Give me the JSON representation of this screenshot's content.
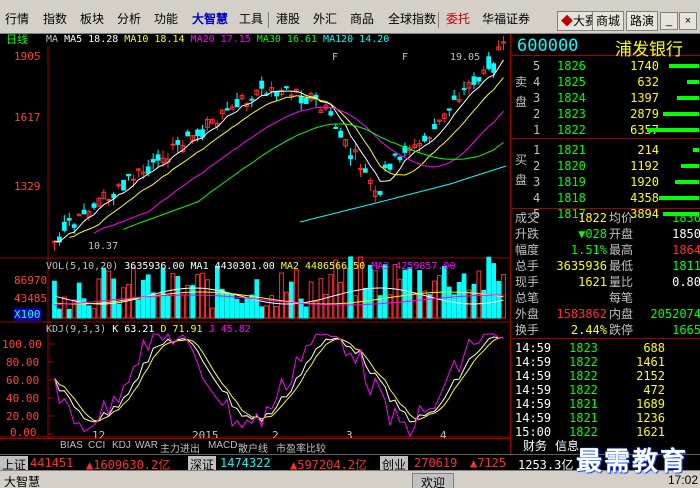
{
  "menu": {
    "items": [
      "行情",
      "指数",
      "板块",
      "分析",
      "功能",
      "大智慧",
      "工具",
      "港股",
      "外汇",
      "商品",
      "全球指数",
      "委托",
      "华福证券"
    ],
    "right_buttons": {
      "dasai": "大赛",
      "shangcheng": "商城",
      "luxiao": "路演"
    },
    "win": {
      "min": "_",
      "max": "□",
      "close": "×"
    }
  },
  "chart": {
    "period_label": "日线",
    "ma_line": {
      "ma": "MA",
      "ma5": "MA5 18.28",
      "ma10": "MA10 18.14",
      "ma20": "MA20 17.15",
      "ma30": "MA30 16.61",
      "ma120": "MA120 14.20"
    },
    "price_ticks": [
      "1905",
      "1617",
      "1329"
    ],
    "high_label": "19.05",
    "low_label": "10.37",
    "markers": {
      "f1": "F",
      "f2": "F"
    },
    "vol_line": {
      "vol": "VOL(5,10,20)",
      "v1": "3635936.00",
      "ma1": "MA1 4430301.00",
      "ma2": "MA2 4486566.50",
      "ma3": "MA3 4259857.00"
    },
    "vol_ticks": [
      "86970",
      "43485",
      "X100"
    ],
    "kdj_line": {
      "kdj": "KDJ(9,3,3)",
      "k": "K 63.21",
      "d": "D 71.91",
      "j": "J 45.82"
    },
    "kdj_ticks": [
      "100.00",
      "80.00",
      "60.00",
      "40.00",
      "20.00",
      "0.00"
    ],
    "x_labels": [
      "12",
      "2015",
      "2",
      "3",
      "4"
    ],
    "colors": {
      "ma5": "#ffffff",
      "ma10": "#ffff00",
      "ma20": "#ff00ff",
      "ma30": "#00ff00",
      "ma120": "#00ffff",
      "up": "#ff3030",
      "down": "#00ffff"
    }
  },
  "bottom_tabs": [
    "BIAS",
    "CCI",
    "KDJ",
    "WAR",
    "主力进出",
    "MACD",
    "散户线",
    "市盈率比较"
  ],
  "quote": {
    "code": "600000",
    "name": "浦发银行",
    "sell_label": "卖盘",
    "buy_label": "买盘",
    "sell": [
      {
        "n": "5",
        "p": "1826",
        "v": "1740"
      },
      {
        "n": "4",
        "p": "1825",
        "v": "632"
      },
      {
        "n": "3",
        "p": "1824",
        "v": "1397"
      },
      {
        "n": "2",
        "p": "1823",
        "v": "2879"
      },
      {
        "n": "1",
        "p": "1822",
        "v": "6357"
      }
    ],
    "buy": [
      {
        "n": "1",
        "p": "1821",
        "v": "214"
      },
      {
        "n": "2",
        "p": "1820",
        "v": "1192"
      },
      {
        "n": "3",
        "p": "1819",
        "v": "1920"
      },
      {
        "n": "4",
        "p": "1818",
        "v": "4358"
      },
      {
        "n": "5",
        "p": "1817",
        "v": "3894"
      }
    ],
    "stats": [
      {
        "l1": "成交",
        "v1": "1822",
        "l2": "均价",
        "v2": "1836"
      },
      {
        "l1": "升跌",
        "v1": "▼028",
        "l2": "开盘",
        "v2": "1850"
      },
      {
        "l1": "幅度",
        "v1": "1.51%",
        "l2": "最高",
        "v2": "1864"
      },
      {
        "l1": "总手",
        "v1": "3635936",
        "l2": "最低",
        "v2": "1811"
      },
      {
        "l1": "现手",
        "v1": "1621",
        "l2": "量比",
        "v2": "0.80"
      },
      {
        "l1": "总笔",
        "v1": "",
        "l2": "每笔",
        "v2": ""
      },
      {
        "l1": "外盘",
        "v1": "1583862",
        "l2": "内盘",
        "v2": "2052074"
      },
      {
        "l1": "换手",
        "v1": "2.44%",
        "l2": "跌停",
        "v2": "1665"
      }
    ],
    "trades": [
      {
        "t": "14:59",
        "p": "1823",
        "v": "688"
      },
      {
        "t": "14:59",
        "p": "1822",
        "v": "1461"
      },
      {
        "t": "14:59",
        "p": "1822",
        "v": "2152"
      },
      {
        "t": "14:59",
        "p": "1822",
        "v": "472"
      },
      {
        "t": "14:59",
        "p": "1821",
        "v": "1689"
      },
      {
        "t": "14:59",
        "p": "1821",
        "v": "1236"
      },
      {
        "t": "15:00",
        "p": "1822",
        "v": "1621"
      }
    ],
    "tabs": {
      "t1": "财务",
      "t2": "信息"
    }
  },
  "ticker": {
    "sh_label": "上证",
    "sh_val": "441451",
    "sh_chg": "▲1609630.2亿",
    "sz_label": "深证",
    "sz_val": "1474322",
    "sz_chg": "▲597204.2亿",
    "cy_label": "创业",
    "cy_val": "270619",
    "cy_chg": "▲7125",
    "cy_end": "1253.3亿"
  },
  "status": {
    "app": "大智慧",
    "welcome": "欢迎",
    "time": "17:02"
  },
  "watermark": "最需教育"
}
